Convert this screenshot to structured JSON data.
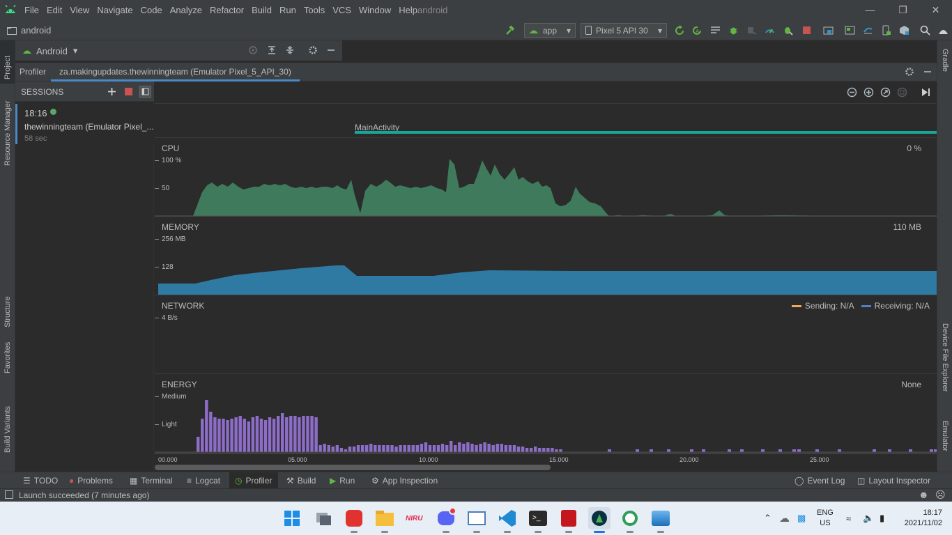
{
  "menubar": {
    "items": [
      "File",
      "Edit",
      "View",
      "Navigate",
      "Code",
      "Analyze",
      "Refactor",
      "Build",
      "Run",
      "Tools",
      "VCS",
      "Window",
      "Help"
    ],
    "project": "android",
    "window_controls": [
      "minimize",
      "restore",
      "close"
    ]
  },
  "navbar": {
    "crumb": "android",
    "run_config": "app",
    "device": "Pixel 5 API 30"
  },
  "left_stripe": [
    "Project",
    "Resource Manager",
    "Structure",
    "Favorites",
    "Build Variants"
  ],
  "right_stripe": [
    "Gradle",
    "Device File Explorer",
    "Emulator"
  ],
  "project_panel": {
    "view": "Android"
  },
  "profiler": {
    "tab_label": "Profiler",
    "session_tab": "za.makingupdates.thewinningteam (Emulator Pixel_5_API_30)"
  },
  "sessions": {
    "header": "SESSIONS",
    "items": [
      {
        "time": "18:16",
        "name": "thewinningteam (Emulator Pixel_...",
        "duration": "58 sec"
      }
    ]
  },
  "timeline": {
    "activity": "MainActivity",
    "cpu": {
      "title": "CPU",
      "value": "0 %",
      "axis": [
        "100 %",
        "50"
      ]
    },
    "memory": {
      "title": "MEMORY",
      "value": "110 MB",
      "axis": [
        "256 MB",
        "128"
      ]
    },
    "network": {
      "title": "NETWORK",
      "axis": [
        "4 B/s"
      ],
      "legend_sending": "Sending: N/A",
      "legend_receiving": "Receiving: N/A"
    },
    "energy": {
      "title": "ENERGY",
      "value": "None",
      "axis": [
        "Medium",
        "Light"
      ]
    },
    "time_axis": [
      "00.000",
      "05.000",
      "10.000",
      "15.000",
      "20.000",
      "25.000"
    ],
    "colors": {
      "cpu": "#3e7a5b",
      "memory": "#2f7aa3",
      "energy": "#8e6dc8",
      "sending": "#f0a860",
      "receiving": "#4f80c8",
      "activity": "#16a79a"
    }
  },
  "tool_tabs": [
    "TODO",
    "Problems",
    "Terminal",
    "Logcat",
    "Profiler",
    "Build",
    "Run",
    "App Inspection"
  ],
  "tool_tabs_right": [
    "Event Log",
    "Layout Inspector"
  ],
  "status": {
    "message": "Launch succeeded (7 minutes ago)"
  },
  "taskbar": {
    "lang_top": "ENG",
    "lang_bottom": "US",
    "time": "18:17",
    "date": "2021/11/02"
  }
}
